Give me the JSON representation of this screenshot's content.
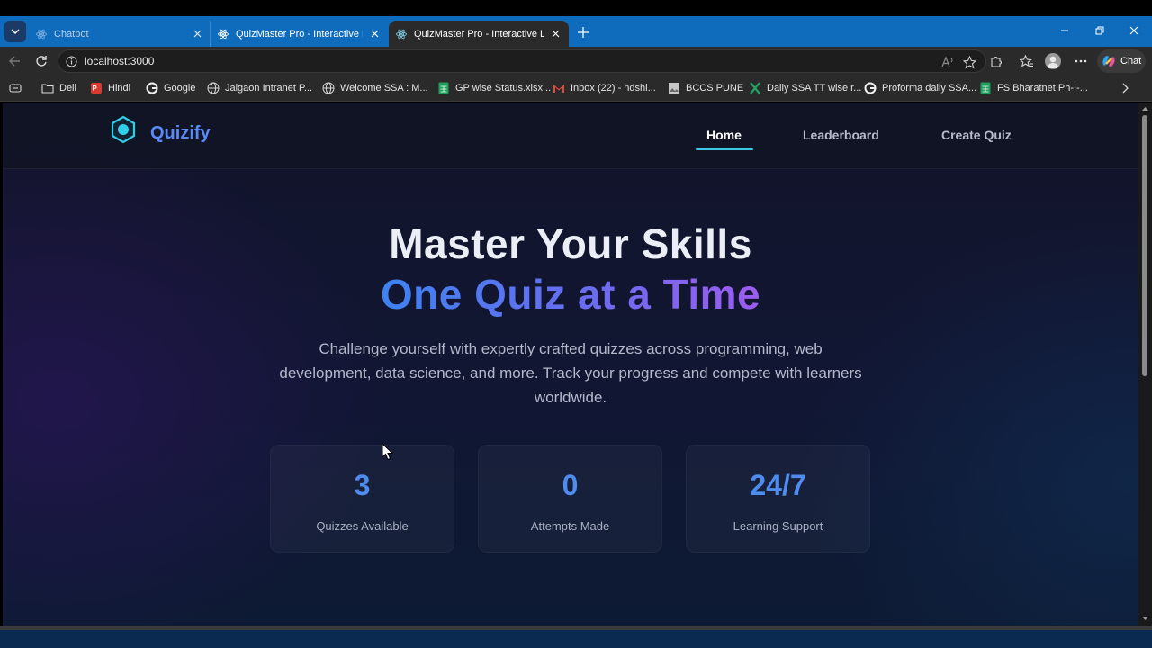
{
  "browser": {
    "tabs": [
      {
        "title": "Chatbot",
        "active": false
      },
      {
        "title": "QuizMaster Pro - Interactive Learn",
        "active": false
      },
      {
        "title": "QuizMaster Pro - Interactive Learn",
        "active": true
      }
    ],
    "address": "localhost:3000",
    "chat_label": "Chat",
    "bookmarks": [
      {
        "label": "Dell",
        "icon": "folder-icon"
      },
      {
        "label": "Hindi",
        "icon": "pdf-icon"
      },
      {
        "label": "Google",
        "icon": "google-icon"
      },
      {
        "label": "Jalgaon Intranet P...",
        "icon": "globe-icon"
      },
      {
        "label": "Welcome SSA : M...",
        "icon": "globe-icon"
      },
      {
        "label": "GP wise Status.xlsx...",
        "icon": "sheets-icon"
      },
      {
        "label": "Inbox (22) - ndshi...",
        "icon": "gmail-icon"
      },
      {
        "label": "BCCS PUNE",
        "icon": "image-icon"
      },
      {
        "label": "Daily SSA TT wise r...",
        "icon": "excel-icon"
      },
      {
        "label": "Proforma daily SSA...",
        "icon": "google-icon"
      },
      {
        "label": "FS Bharatnet Ph-I-...",
        "icon": "sheets-icon"
      }
    ]
  },
  "app": {
    "logo_text": "Quizify",
    "nav": {
      "home": "Home",
      "leaderboard": "Leaderboard",
      "create_quiz": "Create Quiz"
    },
    "hero": {
      "title_line1": "Master Your Skills",
      "title_line2": "One Quiz at a Time",
      "description": "Challenge yourself with expertly crafted quizzes across programming, web development, data science, and more. Track your progress and compete with learners worldwide."
    },
    "stats": [
      {
        "value": "3",
        "label": "Quizzes Available"
      },
      {
        "value": "0",
        "label": "Attempts Made"
      },
      {
        "value": "24/7",
        "label": "Learning Support"
      }
    ]
  },
  "colors": {
    "accent": "#4f8cf0",
    "tab_bar": "#0f6cbd",
    "nav_underline": "#3ec6e0"
  }
}
